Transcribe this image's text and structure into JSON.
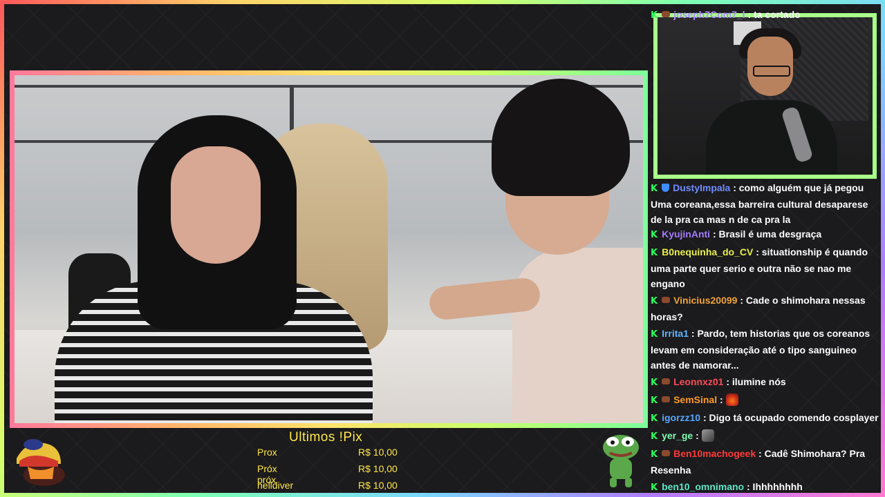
{
  "chat": {
    "messages": [
      {
        "user": "joseph7Com7_l",
        "user_color": "#b08cff",
        "badges": [
          "k",
          "sub"
        ],
        "text": " : ta cortado"
      },
      {
        "user": "DustyImpala",
        "user_color": "#6f8dff",
        "badges": [
          "k",
          "shield"
        ],
        "text": " : como alguém que já pegou Uma coreana,essa barreira cultural desaparese de la pra ca mas n de ca pra la"
      },
      {
        "user": "KyujinAnti",
        "user_color": "#a37cff",
        "badges": [
          "k"
        ],
        "text": " : Brasil é uma desgraça"
      },
      {
        "user": "B0nequinha_do_CV",
        "user_color": "#e9f04a",
        "badges": [
          "k"
        ],
        "text": " : situationship é quando uma parte quer serio e outra não se nao me engano"
      },
      {
        "user": "Vinicius20099",
        "user_color": "#f0a43a",
        "badges": [
          "k",
          "sub"
        ],
        "text": " : Cade o shimohara nessas horas?"
      },
      {
        "user": "Irrita1",
        "user_color": "#5fb5ff",
        "badges": [
          "k"
        ],
        "text": " : Pardo, tem historias que os coreanos levam em consideração até o tipo sanguineo antes de namorar..."
      },
      {
        "user": "Leonnxz01",
        "user_color": "#ff4a5a",
        "badges": [
          "k",
          "sub"
        ],
        "text": " : ilumine nós"
      },
      {
        "user": "SemSinal",
        "user_color": "#ff9a2a",
        "badges": [
          "k",
          "sub"
        ],
        "text": " : ",
        "emote": "emote-fire"
      },
      {
        "user": "igorzz10",
        "user_color": "#54a8ff",
        "badges": [
          "k"
        ],
        "text": " : Digo tá ocupado comendo cosplayer"
      },
      {
        "user": "yer_ge",
        "user_color": "#7dffb0",
        "badges": [
          "k"
        ],
        "text": " : ",
        "emote": "emote-grey"
      },
      {
        "user": "Ben10machogeek",
        "user_color": "#ff3a3a",
        "badges": [
          "k",
          "sub"
        ],
        "text": " : Cadê Shimohara? Pra Resenha"
      },
      {
        "user": "ben10_omnimano",
        "user_color": "#5fe6c8",
        "badges": [
          "k"
        ],
        "text": " : Ihhhhhhhh"
      }
    ]
  },
  "pix": {
    "title": "Ultimos !Pix",
    "rows": [
      {
        "name": "Prox",
        "value": "R$ 10,00"
      },
      {
        "name": "Próx próx",
        "value": "R$ 10,00"
      },
      {
        "name": "helldiver",
        "value": "R$ 10,00"
      }
    ]
  },
  "colors": {
    "pix_yellow": "#ffe94a",
    "chat_badge_green": "#2bff5c",
    "frame_gradient": [
      "#ff5a5a",
      "#ffd36b",
      "#d6ff6b",
      "#7dffb3",
      "#7ad7ff",
      "#b07bff",
      "#ff7ad0"
    ]
  }
}
